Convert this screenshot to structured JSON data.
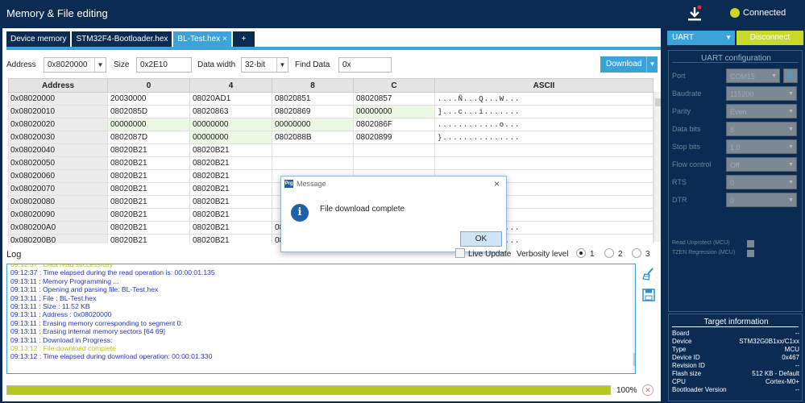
{
  "app": {
    "title": "Memory & File editing"
  },
  "status": {
    "connected_label": "Connected",
    "connected_color": "#c9d92a"
  },
  "tabs": [
    {
      "label": "Device memory"
    },
    {
      "label": "STM32F4-Bootloader.hex"
    },
    {
      "label": "BL-Test.hex",
      "close": "×"
    },
    {
      "label": "+"
    }
  ],
  "controls": {
    "address_label": "Address",
    "address_value": "0x8020000",
    "size_label": "Size",
    "size_value": "0x2E10",
    "width_label": "Data width",
    "width_value": "32-bit",
    "find_label": "Find Data",
    "find_value": "0x",
    "download_label": "Download"
  },
  "table": {
    "headers": [
      "Address",
      "0",
      "4",
      "8",
      "C",
      "ASCII"
    ],
    "rows": [
      {
        "addr": "0x08020000",
        "c0": "20030000",
        "c4": "08020AD1",
        "c8": "08020851",
        "cC": "08020857",
        "ascii": "....Ñ...Q...W..."
      },
      {
        "addr": "0x08020010",
        "c0": "0802085D",
        "c4": "08020863",
        "c8": "08020869",
        "cC": "00000000",
        "ascii": "]...c...i......."
      },
      {
        "addr": "0x08020020",
        "c0": "00000000",
        "c4": "00000000",
        "c8": "00000000",
        "cC": "0802086F",
        "ascii": "............o..."
      },
      {
        "addr": "0x08020030",
        "c0": "0802087D",
        "c4": "00000000",
        "c8": "0802088B",
        "cC": "08020899",
        "ascii": "}..............."
      },
      {
        "addr": "0x08020040",
        "c0": "08020B21",
        "c4": "08020B21",
        "c8": "",
        "cC": "",
        "ascii": ""
      },
      {
        "addr": "0x08020050",
        "c0": "08020B21",
        "c4": "08020B21",
        "c8": "",
        "cC": "",
        "ascii": ""
      },
      {
        "addr": "0x08020060",
        "c0": "08020B21",
        "c4": "08020B21",
        "c8": "",
        "cC": "",
        "ascii": ""
      },
      {
        "addr": "0x08020070",
        "c0": "08020B21",
        "c4": "08020B21",
        "c8": "",
        "cC": "",
        "ascii": ""
      },
      {
        "addr": "0x08020080",
        "c0": "08020B21",
        "c4": "08020B21",
        "c8": "",
        "cC": "",
        "ascii": ""
      },
      {
        "addr": "0x08020090",
        "c0": "08020B21",
        "c4": "08020B21",
        "c8": "",
        "cC": "",
        "ascii": ""
      },
      {
        "addr": "0x080200A0",
        "c0": "08020B21",
        "c4": "08020B21",
        "c8": "08020B21",
        "cC": "08020B21",
        "ascii": "!...!...!...!..."
      },
      {
        "addr": "0x080200B0",
        "c0": "08020B21",
        "c4": "08020B21",
        "c8": "08020B21",
        "cC": "08020B21",
        "ascii": "!...!...!...!..."
      }
    ]
  },
  "dialog": {
    "title": "Message",
    "message": "File download complete",
    "ok_label": "OK",
    "close": "×",
    "badge": "Prg",
    "info_glyph": "i"
  },
  "log": {
    "label": "Log",
    "live_update_label": "Live Update",
    "verbosity_label": "Verbosity level",
    "levels": [
      "1",
      "2",
      "3"
    ],
    "lines": [
      {
        "text": "09:12:37 : Data read successfully",
        "kind": "ok"
      },
      {
        "text": "09:12:37 : Time elapsed during the read operation is: 00:00:01.135",
        "kind": "info"
      },
      {
        "text": "09:13:11 : Memory Programming ...",
        "kind": "info"
      },
      {
        "text": "09:13:11 : Opening and parsing file: BL-Test.hex",
        "kind": "info"
      },
      {
        "text": "09:13:11 :   File          : BL-Test.hex",
        "kind": "info"
      },
      {
        "text": "09:13:11 :   Size          : 11.52 KB",
        "kind": "info"
      },
      {
        "text": "09:13:11 :   Address       : 0x08020000",
        "kind": "info"
      },
      {
        "text": "09:13:11 : Erasing memory corresponding to segment 0:",
        "kind": "info"
      },
      {
        "text": "09:13:11 : Erasing internal memory sectors [64 69]",
        "kind": "info"
      },
      {
        "text": "09:13:11 : Download in Progress:",
        "kind": "info"
      },
      {
        "text": "09:13:12 : File download complete",
        "kind": "ok"
      },
      {
        "text": "09:13:12 : Time elapsed during download operation: 00:00:01.330",
        "kind": "info"
      }
    ]
  },
  "progress": {
    "value_fraction": 1.0,
    "label": "100%",
    "color": "#b4c820"
  },
  "connection": {
    "interface": "UART",
    "disconnect_label": "Disconnect"
  },
  "uart_config": {
    "title": "UART configuration",
    "fields": [
      {
        "label": "Port",
        "value": "COM15"
      },
      {
        "label": "Baudrate",
        "value": "115200"
      },
      {
        "label": "Parity",
        "value": "Even"
      },
      {
        "label": "Data bits",
        "value": "8"
      },
      {
        "label": "Stop bits",
        "value": "1.0"
      },
      {
        "label": "Flow control",
        "value": "Off"
      },
      {
        "label": "RTS",
        "value": "0"
      },
      {
        "label": "DTR",
        "value": "0"
      }
    ],
    "read_unprotect_label": "Read Unprotect (MCU)",
    "tzen_label": "TZEN Regression (MCU)",
    "refresh_glyph": "⟳"
  },
  "target": {
    "title": "Target information",
    "rows": [
      {
        "key": "Board",
        "value": "--"
      },
      {
        "key": "Device",
        "value": "STM32G0B1xx/C1xx"
      },
      {
        "key": "Type",
        "value": "MCU"
      },
      {
        "key": "Device ID",
        "value": "0x467"
      },
      {
        "key": "Revision ID",
        "value": "--"
      },
      {
        "key": "Flash size",
        "value": "512 KB - Default"
      },
      {
        "key": "CPU",
        "value": "Cortex-M0+"
      },
      {
        "key": "Bootloader Version",
        "value": "--"
      }
    ]
  }
}
